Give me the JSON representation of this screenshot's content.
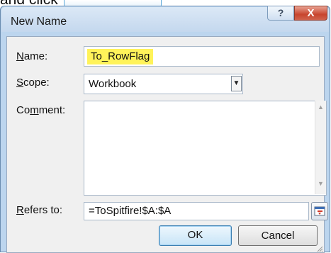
{
  "caption": {
    "prefix": "and click",
    "suffix": "."
  },
  "dialog": {
    "title": "New Name",
    "help_label": "?",
    "close_label": "X",
    "name": {
      "label_ul": "N",
      "label_rest": "ame:",
      "value": "To_RowFlag"
    },
    "scope": {
      "label_ul": "S",
      "label_rest": "cope:",
      "value": "Workbook"
    },
    "comment": {
      "label_pre": "Co",
      "label_ul": "m",
      "label_rest": "ment:",
      "value": ""
    },
    "refers_to": {
      "label_ul": "R",
      "label_rest": "efers to:",
      "value": "=ToSpitfire!$A:$A"
    },
    "ok_label": "OK",
    "cancel_label": "Cancel"
  },
  "colors": {
    "highlight": "#fff35a",
    "title_bar": "#c4d8ee",
    "close_button": "#c8452e",
    "ok_focus_border": "#3c7fb1"
  },
  "icons": {
    "dropdown": "triangle-down",
    "scroll_up": "triangle-up",
    "scroll_down": "triangle-down",
    "range_picker": "collapse-dialog"
  }
}
